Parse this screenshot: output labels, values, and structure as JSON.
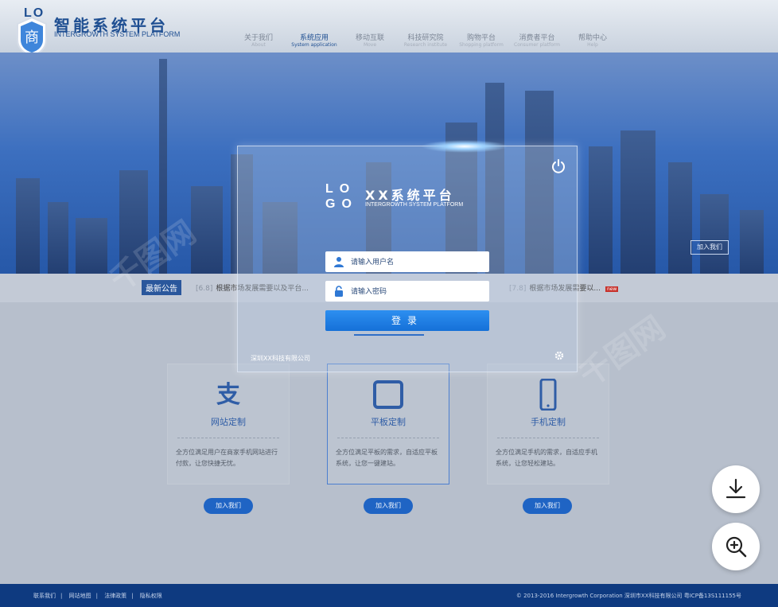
{
  "header": {
    "logo_lo": "LO",
    "badge_char": "商",
    "title": "智能系统平台",
    "subtitle": "INTERGROWTH SYSTEM PLATFORM",
    "nav": [
      {
        "label": "关于我们",
        "sub": "About"
      },
      {
        "label": "系统应用",
        "sub": "System application"
      },
      {
        "label": "移动互联",
        "sub": "Move"
      },
      {
        "label": "科技研究院",
        "sub": "Research institute"
      },
      {
        "label": "购物平台",
        "sub": "Shopping platform"
      },
      {
        "label": "消费者平台",
        "sub": "Consumer platform"
      },
      {
        "label": "帮助中心",
        "sub": "Help"
      }
    ]
  },
  "hero": {
    "join_label": "加入我们"
  },
  "notice": {
    "label": "最新公告",
    "items": [
      {
        "date": "[6.8]",
        "text": "根据市场发展需要以及平台..."
      },
      {
        "date": "[7.8]",
        "text": "根据市场发展需要以...",
        "tag": "new"
      }
    ]
  },
  "login": {
    "logo_lo": "LO",
    "logo_go": "GO",
    "title": "XX系统平台",
    "subtitle": "INTERGROWTH SYSTEM PLATFORM",
    "username_placeholder": "请输入用户名",
    "password_placeholder": "请输入密码",
    "login_label": "登录",
    "company": "深圳XX科技有限公司"
  },
  "cards": [
    {
      "title": "网站定制",
      "desc": "全方位满足用户在商家手机网站进行付款，让您快捷无忧。",
      "button": "加入我们"
    },
    {
      "title": "平板定制",
      "desc": "全方位满足平板的需求，自适应平板系统，让您一键建站。",
      "button": "加入我们"
    },
    {
      "title": "手机定制",
      "desc": "全方位满足手机的需求，自适应手机系统，让您轻松建站。",
      "button": "加入我们"
    }
  ],
  "footer": {
    "links": [
      "联系我们",
      "网站地图",
      "法律政策",
      "隐私权限"
    ],
    "copyright": "© 2013-2016 Intergrowth Corporation 深圳市XX科技有限公司 粤ICP备13S111155号"
  },
  "watermark": "千图网"
}
